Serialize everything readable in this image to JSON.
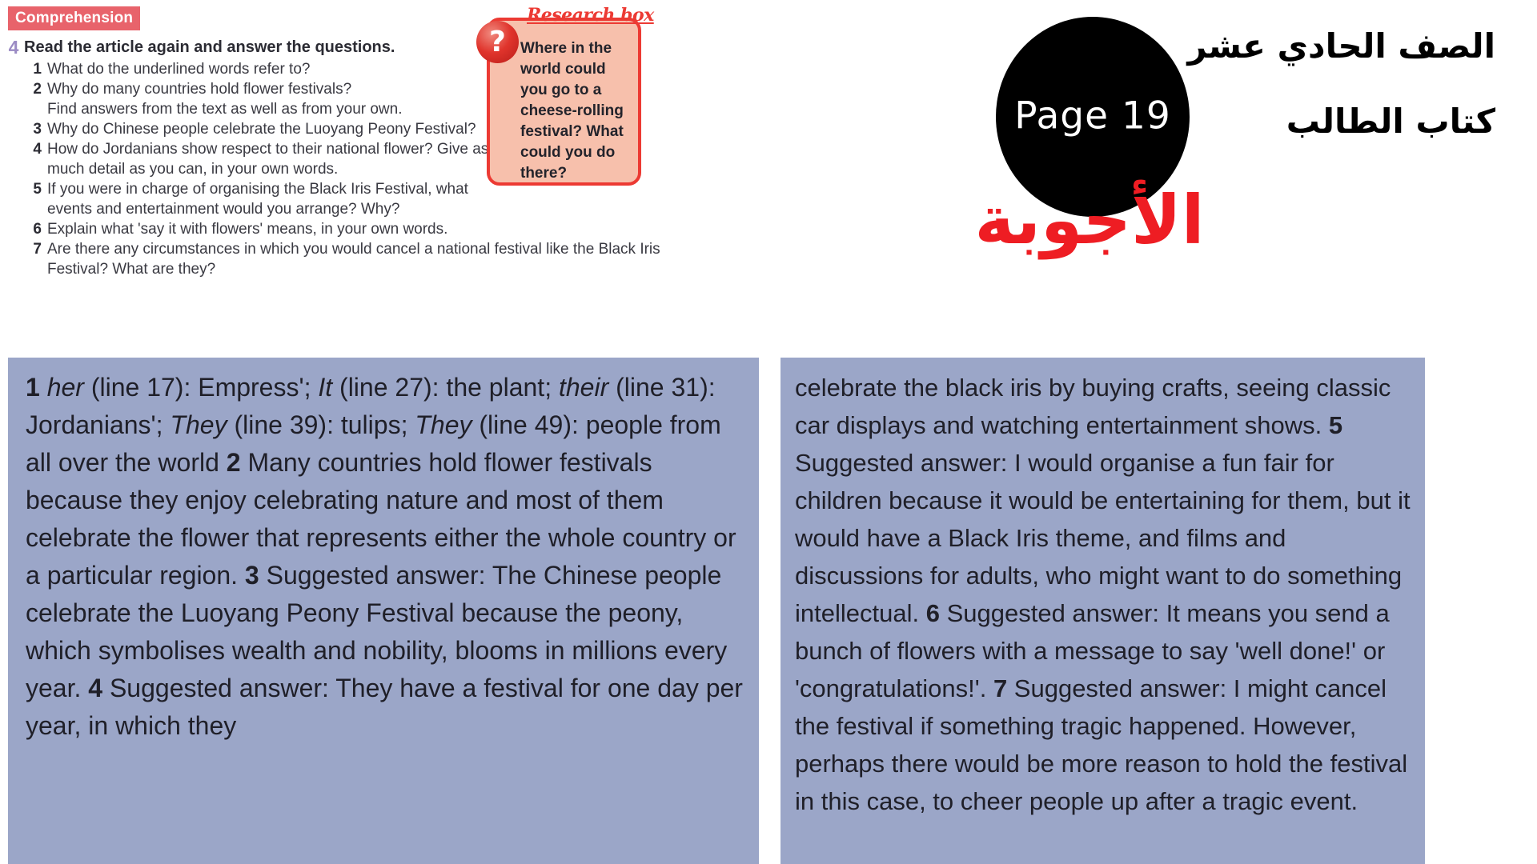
{
  "comprehension": {
    "badge_label": "Comprehension",
    "exercise_number": "4",
    "instruction": "Read the article again and answer the questions.",
    "questions": [
      {
        "num": "1",
        "line1": "What do the underlined words refer to?",
        "line2": ""
      },
      {
        "num": "2",
        "line1": "Why do many countries hold flower festivals?",
        "line2": "Find answers from the text as well as from your own."
      },
      {
        "num": "3",
        "line1": "Why do Chinese people celebrate the Luoyang Peony Festival?",
        "line2": ""
      },
      {
        "num": "4",
        "line1": "How do Jordanians show respect to their national flower? Give as",
        "line2": "much detail as you can, in your own words."
      },
      {
        "num": "5",
        "line1": "If you were in charge of organising the Black Iris Festival, what",
        "line2": "events and entertainment would you arrange? Why?"
      },
      {
        "num": "6",
        "line1": "Explain what 'say it with flowers' means, in your own words.",
        "line2": ""
      },
      {
        "num": "7",
        "line1": "Are there any circumstances in which you would cancel a national festival like the Black Iris",
        "line2": "Festival? What are they?"
      }
    ]
  },
  "research_box": {
    "title": "Research box",
    "icon_label": "?",
    "text": "Where in the world could you go to a cheese-rolling festival? What could you do there?"
  },
  "header": {
    "page_circle_label": "Page 19",
    "arabic_grade": "الصف الحادي عشر",
    "arabic_book": "كتاب الطالب",
    "arabic_answers": "الأجوبة"
  },
  "answers": {
    "left_column": [
      {
        "num": "1",
        "kind": "refs",
        "parts": [
          {
            "style": "italic",
            "text": "her"
          },
          {
            "style": "plain",
            "text": " (line 17): Empress'; "
          },
          {
            "style": "italic",
            "text": "It"
          },
          {
            "style": "plain",
            "text": " (line 27): the plant; "
          },
          {
            "style": "italic",
            "text": "their"
          },
          {
            "style": "plain",
            "text": " (line 31): Jordanians'; "
          },
          {
            "style": "italic",
            "text": "They"
          },
          {
            "style": "plain",
            "text": " (line 39): tulips; "
          },
          {
            "style": "italic",
            "text": "They"
          },
          {
            "style": "plain",
            "text": " (line 49): people from all over the world"
          }
        ]
      },
      {
        "num": "2",
        "kind": "plain",
        "text": "Many countries hold flower festivals because they enjoy celebrating nature and most of them celebrate the flower that represents either the whole country or a particular region."
      },
      {
        "num": "3",
        "kind": "plain",
        "text": "Suggested answer: The Chinese people celebrate the Luoyang Peony Festival because the peony, which symbolises wealth and nobility, blooms in millions every year."
      },
      {
        "num": "4",
        "kind": "plain",
        "text": "Suggested answer: They have a festival for one day per year, in which they"
      }
    ],
    "right_column": [
      {
        "num": "",
        "kind": "plain",
        "text": "celebrate the black iris by buying crafts, seeing classic car displays and watching entertainment shows."
      },
      {
        "num": "5",
        "kind": "plain",
        "text": "Suggested answer: I would organise a fun fair for children because it would be entertaining for them, but it would have a Black Iris theme, and films and discussions for adults, who might want to do something intellectual."
      },
      {
        "num": "6",
        "kind": "plain",
        "text": "Suggested answer: It means you send a bunch of flowers with a message to say 'well done!' or 'congratulations!'."
      },
      {
        "num": "7",
        "kind": "plain",
        "text": "Suggested answer: I might cancel the festival if something tragic happened. However, perhaps there would be more reason to hold the festival in this case, to cheer people up after a tragic event."
      }
    ]
  },
  "colors": {
    "badge_red": "#e8636b",
    "exercise_purple": "#9b8bc4",
    "research_border": "#ec3a33",
    "research_fill": "#f7c0ac",
    "answer_panel": "#9ba6c8",
    "arabic_answers_red": "#ee1d23"
  }
}
